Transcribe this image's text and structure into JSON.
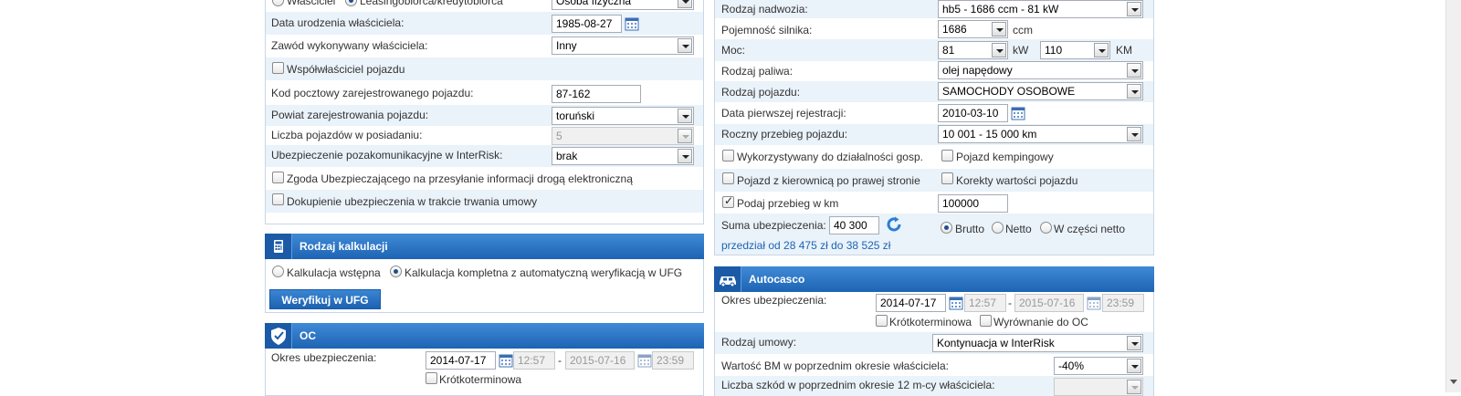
{
  "left": {
    "owner_type": {
      "opt1": "Właściciel",
      "opt2": "Leasingobiorca/kredytobiorca",
      "select": "Osoba fizyczna"
    },
    "birth_date": {
      "label": "Data urodzenia właściciela:",
      "value": "1985-08-27"
    },
    "profession": {
      "label": "Zawód wykonywany właściciela:",
      "value": "Inny"
    },
    "co_owner": {
      "label": "Współwłaściciel pojazdu"
    },
    "postal_code": {
      "label": "Kod pocztowy zarejestrowanego pojazdu:",
      "value": "87-162"
    },
    "district": {
      "label": "Powiat zarejestrowania pojazdu:",
      "value": "toruński"
    },
    "vehicle_count": {
      "label": "Liczba pojazdów w posiadaniu:",
      "value": "5"
    },
    "non_motor": {
      "label": "Ubezpieczenie pozakomunikacyjne w  InterRisk:",
      "value": "brak"
    },
    "consent": {
      "label": "Zgoda Ubezpieczającego na przesyłanie informacji drogą elektroniczną"
    },
    "purchase": {
      "label": "Dokupienie ubezpieczenia w trakcie trwania umowy"
    }
  },
  "calc": {
    "title": "Rodzaj kalkulacji",
    "opt1": "Kalkulacja wstępna",
    "opt2": "Kalkulacja kompletna z automatyczną weryfikacją w UFG",
    "verify_button": "Weryfikuj w UFG"
  },
  "oc": {
    "title": "OC",
    "period_label": "Okres ubezpieczenia:",
    "date_from": "2014-07-17",
    "time_from": "12:57",
    "dash": "-",
    "date_to": "2015-07-16",
    "time_to": "23:59",
    "short_term": "Krótkoterminowa"
  },
  "right": {
    "body_type": {
      "label": "Rodzaj nadwozia:",
      "value": "hb5 - 1686 ccm - 81 kW"
    },
    "engine": {
      "label": "Pojemność silnika:",
      "value": "1686",
      "unit": "ccm"
    },
    "power": {
      "label": "Moc:",
      "kw_value": "81",
      "kw_unit": "kW",
      "km_value": "110",
      "km_unit": "KM"
    },
    "fuel": {
      "label": "Rodzaj paliwa:",
      "value": "olej napędowy"
    },
    "vehicle_type": {
      "label": "Rodzaj pojazdu:",
      "value": "SAMOCHODY OSOBOWE"
    },
    "first_reg": {
      "label": "Data pierwszej rejestracji:",
      "value": "2010-03-10"
    },
    "mileage": {
      "label": "Roczny przebieg pojazdu:",
      "value": "10 001 - 15 000 km"
    },
    "business_use": {
      "label": "Wykorzystywany do działalności gosp."
    },
    "camping": {
      "label": "Pojazd kempingowy"
    },
    "rhd": {
      "label": "Pojazd z kierownicą po prawej stronie"
    },
    "value_corr": {
      "label": "Korekty wartości pojazdu"
    },
    "odometer": {
      "label": "Podaj przebieg w km",
      "value": "100000"
    },
    "sum": {
      "label": "Suma ubezpieczenia:",
      "value": "40 300",
      "range": "przedział od 28 475 zł do 38 525 zł"
    },
    "gross": {
      "opt1": "Brutto",
      "opt2": "Netto",
      "opt3": "W części netto"
    }
  },
  "ac": {
    "title": "Autocasco",
    "period_label": "Okres ubezpieczenia:",
    "date_from": "2014-07-17",
    "time_from": "12:57",
    "dash": "-",
    "date_to": "2015-07-16",
    "time_to": "23:59",
    "short_term": "Krótkoterminowa",
    "oc_align": "Wyrównanie do OC",
    "contract_label": "Rodzaj umowy:",
    "contract_value": "Kontynuacja w InterRisk",
    "bm_label": "Wartość BM w poprzednim okresie właściciela:",
    "bm_value": "-40%",
    "claims_label": "Liczba szkód w poprzednim okresie 12 m-cy właściciela:"
  },
  "colors": {
    "header_blue": "#1e64b4",
    "band": "#eaf2fa"
  }
}
